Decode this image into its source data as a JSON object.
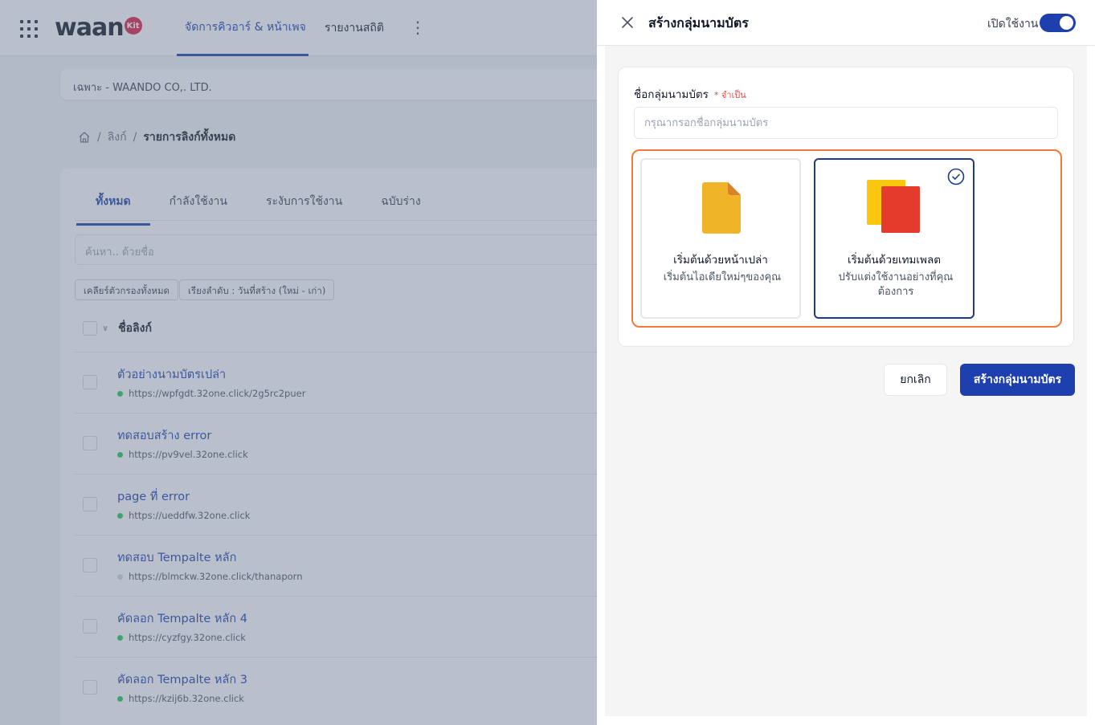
{
  "app": {
    "logo_text": "waan",
    "logo_badge": "Kit",
    "nav": [
      {
        "label": "จัดการคิวอาร์ & หน้าเพจ",
        "active": true
      },
      {
        "label": "รายงานสถิติ",
        "active": false
      }
    ],
    "more_symbol": "⋮",
    "workspace": "เฉพาะ - WAANDO CO,. LTD.",
    "breadcrumb": {
      "sep": "/",
      "parent": "ลิงก์",
      "current": "รายการลิงก์ทั้งหมด"
    },
    "tabs": [
      "ทั้งหมด",
      "กำลังใช้งาน",
      "ระงับการใช้งาน",
      "ฉบับร่าง"
    ],
    "search_placeholder": "ค้นหา.. ด้วยชื่อ",
    "chips": [
      "เคลียร์ตัวกรองทั้งหมด",
      "เรียงลำดับ : วันที่สร้าง (ใหม่ - เก่า)"
    ],
    "list_header": "ชื่อลิงก์",
    "rows": [
      {
        "title": "ตัวอย่างนามบัตรเปล่า",
        "url": "https://wpfgdt.32one.click/2g5rc2puer",
        "status": "active"
      },
      {
        "title": "ทดสอบสร้าง error",
        "url": "https://pv9vel.32one.click",
        "status": "active"
      },
      {
        "title": "page ที่ error",
        "url": "https://ueddfw.32one.click",
        "status": "active"
      },
      {
        "title": "ทดสอบ Tempalte หลัก",
        "url": "https://blmckw.32one.click/thanaporn",
        "status": "inactive"
      },
      {
        "title": "คัดลอก Tempalte หลัก 4",
        "url": "https://cyzfgy.32one.click",
        "status": "active"
      },
      {
        "title": "คัดลอก Tempalte หลัก 3",
        "url": "https://kzij6b.32one.click",
        "status": "active"
      }
    ]
  },
  "drawer": {
    "title": "สร้างกลุ่มนามบัตร",
    "toggle_label": "เปิดใช้งาน",
    "toggle_on": true,
    "field_label": "ชื่อกลุ่มนามบัตร",
    "required_text": "* จำเป็น",
    "input_placeholder": "กรุณากรอกชื่อกลุ่มนามบัตร",
    "input_value": "",
    "options": [
      {
        "title": "เริ่มต้นด้วยหน้าเปล่า",
        "desc": "เริ่มต้นไอเดียใหม่ๆของคุณ",
        "selected": false
      },
      {
        "title": "เริ่มต้นด้วยเทมเพลต",
        "desc": "ปรับแต่งใช้งานอย่างที่คุณต้องการ",
        "selected": true
      }
    ],
    "cancel_label": "ยกเลิก",
    "submit_label": "สร้างกลุ่มนามบัตร"
  },
  "colors": {
    "primary": "#1e40af",
    "highlight_border": "#f07a3a",
    "blank_icon": "#f0b429",
    "template_back": "#f9c80e",
    "template_front": "#e53b2c",
    "active_dot": "#22c55e"
  },
  "icons": [
    "apps-grid-icon",
    "home-icon",
    "close-icon",
    "blank-page-icon",
    "template-icon",
    "check-circle-icon",
    "chevron-down-icon"
  ]
}
